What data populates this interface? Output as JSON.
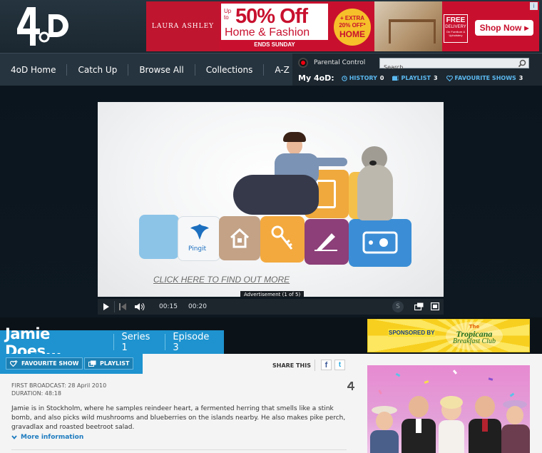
{
  "brand": {
    "logo": "4oD"
  },
  "ad_banner": {
    "advertiser": "LAURA ASHLEY",
    "up_to": "Up to",
    "headline": "50% Off",
    "subhead": "Home & Fashion",
    "footer": "ENDS SUNDAY",
    "extra_line1": "+ EXTRA",
    "extra_line2": "20% OFF*",
    "extra_line3": "HOME",
    "free_line1": "FREE",
    "free_line2": "DELIVERY",
    "free_line3": "On Furniture & Upholstery",
    "cta": "Shop Now",
    "info_icon": "i"
  },
  "nav": {
    "items": [
      {
        "label": "4oD Home"
      },
      {
        "label": "Catch Up"
      },
      {
        "label": "Browse All"
      },
      {
        "label": "Collections"
      },
      {
        "label": "A-Z"
      }
    ]
  },
  "my4od": {
    "parental_control": "Parental Control",
    "search_placeholder": "Search",
    "label": "My 4oD:",
    "history_label": "HISTORY",
    "history_count": "0",
    "playlist_label": "PLAYLIST",
    "playlist_count": "3",
    "favourites_label": "FAVOURITE SHOWS",
    "favourites_count": "3"
  },
  "player": {
    "cta": "CLICK HERE TO FIND OUT MORE",
    "ad_counter": "Advertisement (1 of 5)",
    "elapsed": "00:15",
    "duration": "00:20",
    "block_label": "Pingit",
    "subtitle_button": "S"
  },
  "show": {
    "title": "Jamie Does...",
    "series": "Series 1",
    "episode": "Episode 3"
  },
  "sponsor": {
    "label": "SPONSORED BY",
    "brand_top": "The",
    "brand": "Tropicana",
    "brand_sub": "Breakfast Club"
  },
  "actions": {
    "favourite": "FAVOURITE SHOW",
    "playlist": "PLAYLIST",
    "share": "SHARE THIS",
    "facebook": "f",
    "twitter": "t"
  },
  "episode_info": {
    "first_broadcast": "FIRST BROADCAST: 28 April 2010",
    "duration": "DURATION: 48:18",
    "description": "Jamie is in Stockholm, where he samples reindeer heart, a fermented herring that smells like a stink bomb, and also picks wild mushrooms and blueberries on the islands nearby. He also makes pike perch, gravadlax and roasted beetroot salad.",
    "more_info": "More information"
  },
  "colors": {
    "brand_blue": "#1e93cf",
    "header_bg": "#25343f",
    "link_blue": "#5bb8ef",
    "ad_red": "#c8102e"
  }
}
